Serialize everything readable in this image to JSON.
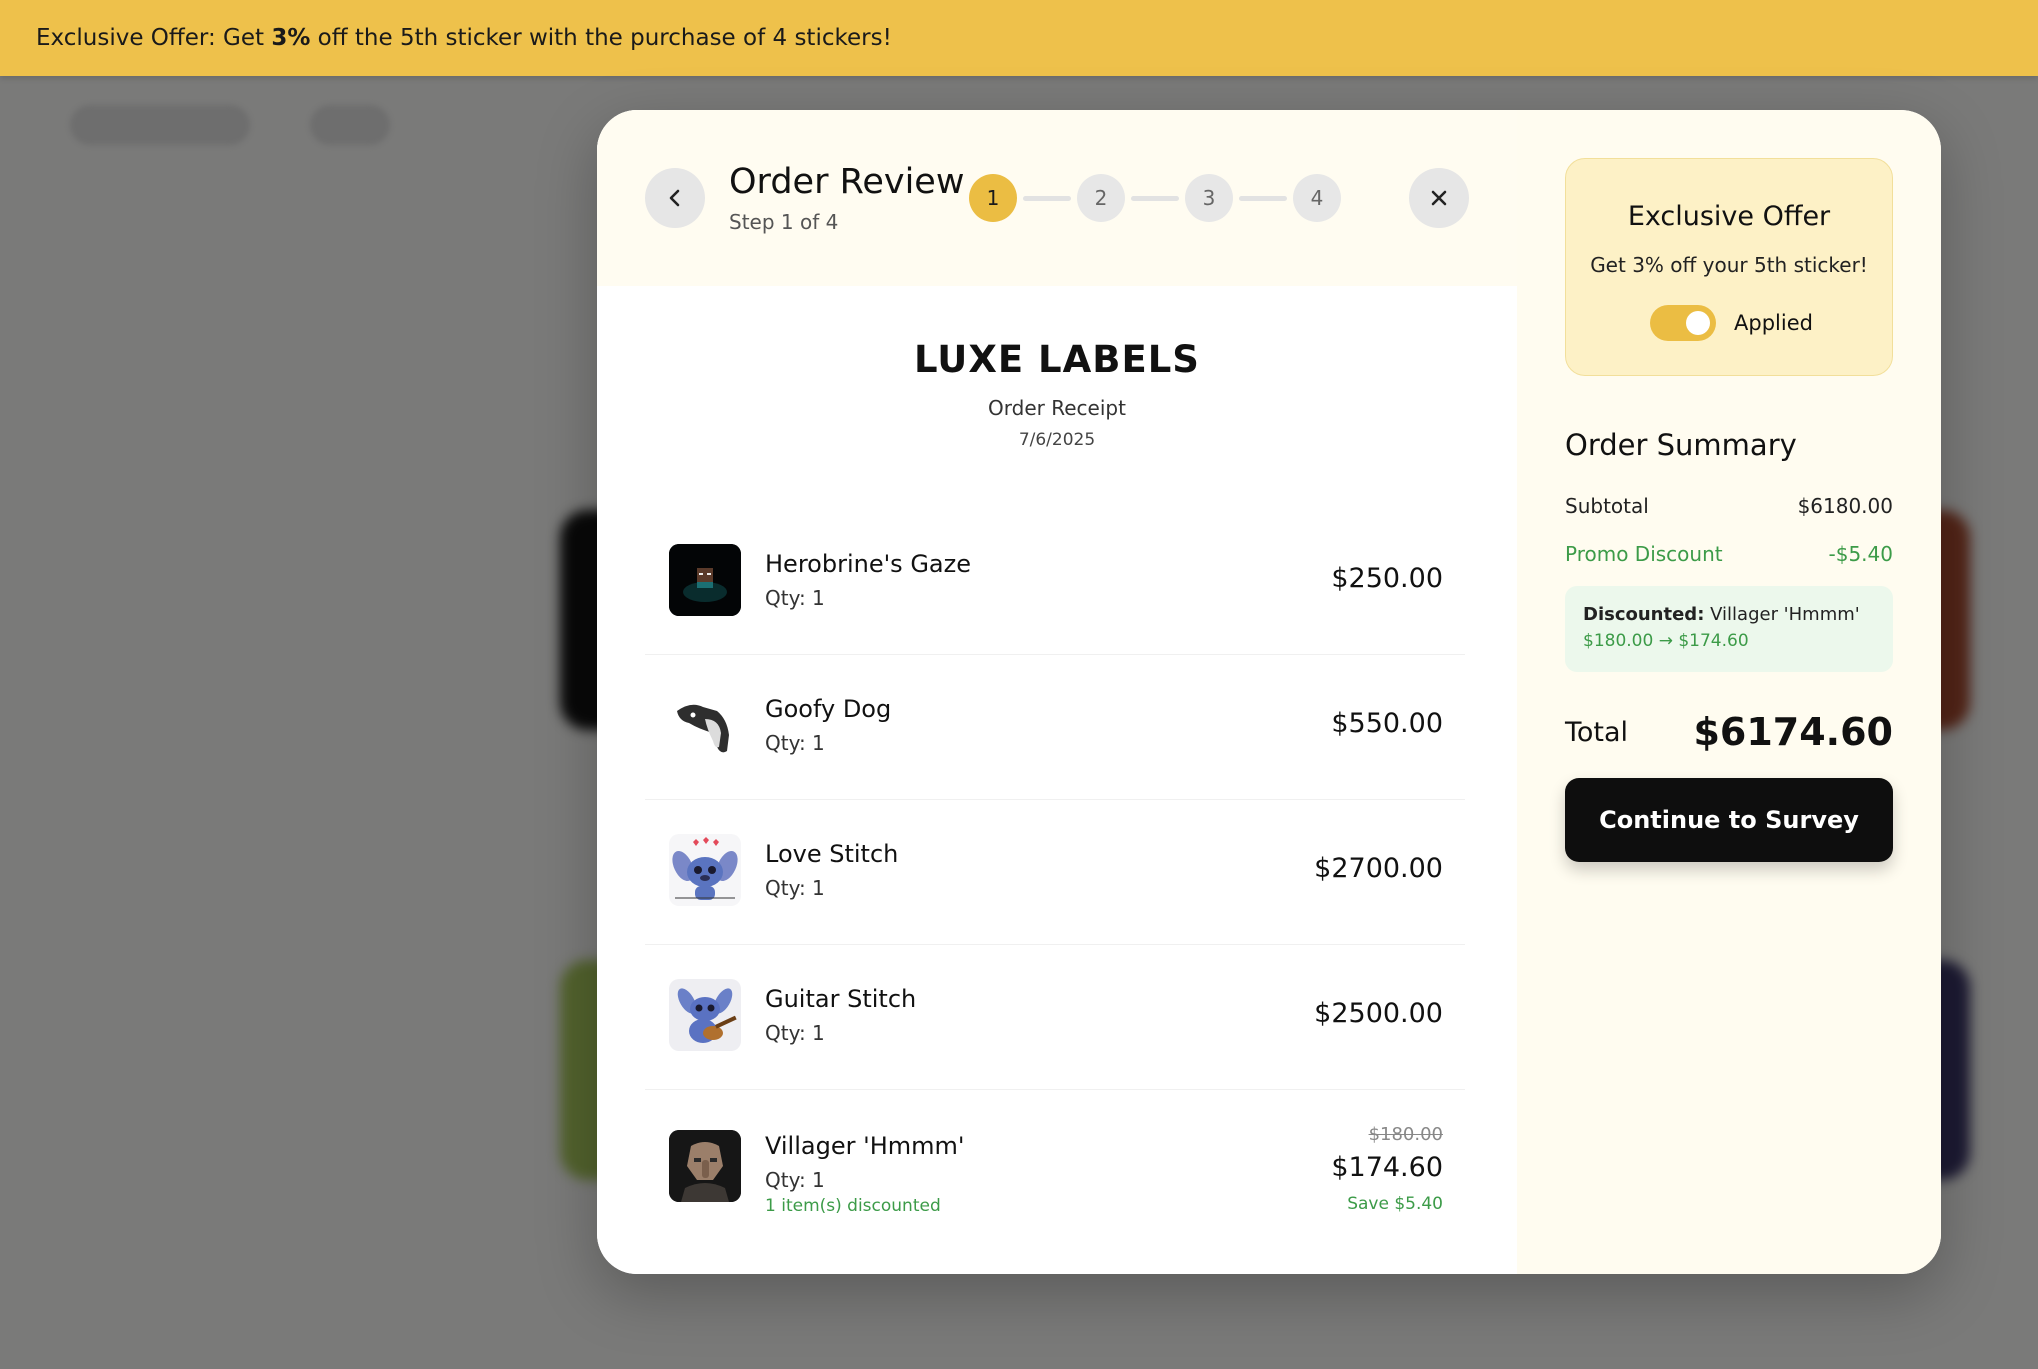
{
  "banner": {
    "prefix": "Exclusive Offer: Get ",
    "highlight": "3%",
    "suffix": " off the 5th sticker with the purchase of 4 stickers!"
  },
  "modal": {
    "title": "Order Review",
    "subtitle": "Step 1 of 4",
    "steps": [
      "1",
      "2",
      "3",
      "4"
    ],
    "active_step": 1
  },
  "receipt": {
    "brand": "LUXE LABELS",
    "label": "Order Receipt",
    "date": "7/6/2025",
    "items": [
      {
        "name": "Herobrine's Gaze",
        "qty": "Qty: 1",
        "price": "$250.00"
      },
      {
        "name": "Goofy Dog",
        "qty": "Qty: 1",
        "price": "$550.00"
      },
      {
        "name": "Love Stitch",
        "qty": "Qty: 1",
        "price": "$2700.00"
      },
      {
        "name": "Guitar Stitch",
        "qty": "Qty: 1",
        "price": "$2500.00"
      },
      {
        "name": "Villager 'Hmmm'",
        "qty": "Qty: 1",
        "discount_note": "1 item(s) discounted",
        "old_price": "$180.00",
        "price": "$174.60",
        "save": "Save $5.40"
      }
    ]
  },
  "offer": {
    "title": "Exclusive Offer",
    "description": "Get 3% off your 5th sticker!",
    "toggle_label": "Applied",
    "toggle_on": true
  },
  "summary": {
    "title": "Order Summary",
    "subtotal_label": "Subtotal",
    "subtotal_value": "$6180.00",
    "promo_label": "Promo Discount",
    "promo_value": "-$5.40",
    "discounted_label": "Discounted:",
    "discounted_item": " Villager 'Hmmm'",
    "discounted_change": "$180.00 → $174.60",
    "total_label": "Total",
    "total_value": "$6174.60",
    "cta_label": "Continue to Survey"
  },
  "colors": {
    "accent": "#eec14b",
    "success": "#3c9b48",
    "cta": "#0e0e0e"
  },
  "icons": {
    "back": "chevron-left-icon",
    "close": "close-icon"
  }
}
